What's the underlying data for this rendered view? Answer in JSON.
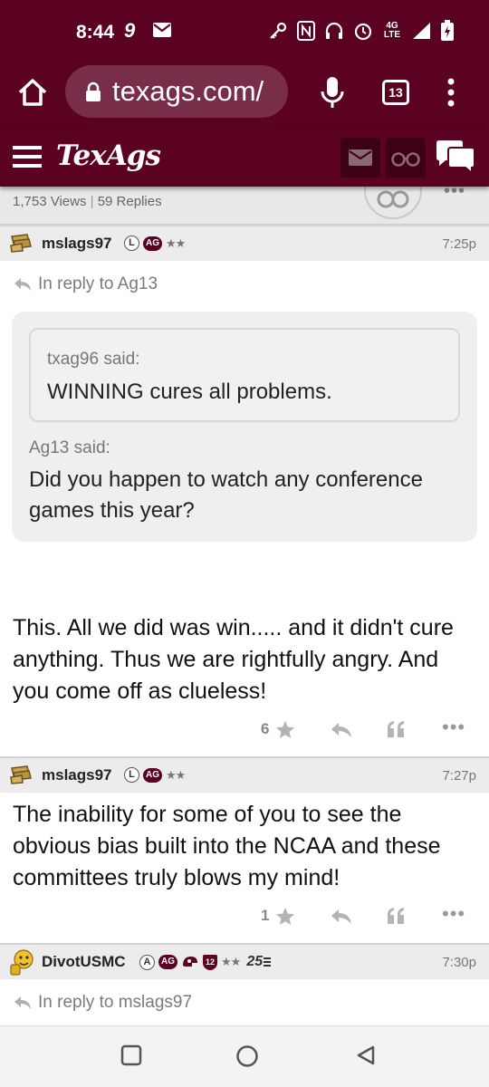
{
  "status_bar": {
    "time": "8:44",
    "network": "4G LTE"
  },
  "browser": {
    "url": "texags.com/",
    "tab_count": "13"
  },
  "site": {
    "logo": "TexAgs"
  },
  "thread": {
    "views": "1,753 Views",
    "separator": "|",
    "replies": "59 Replies"
  },
  "posts": [
    {
      "username": "mslags97",
      "badge_l": "L",
      "badge_ag": "AG",
      "stars": "★★",
      "time": "7:25p",
      "reply_to": "In reply to Ag13",
      "quote_outer_author": "Ag13 said:",
      "quote_outer_text": "Did you happen to watch any conference games this year?",
      "quote_inner_author": "txag96 said:",
      "quote_inner_text": "WINNING cures all problems.",
      "body": "This. All we did was win..... and it didn't cure anything. Thus we are rightfully angry. And you come off as clueless!",
      "likes": "6"
    },
    {
      "username": "mslags97",
      "badge_l": "L",
      "badge_ag": "AG",
      "stars": "★★",
      "time": "7:27p",
      "body": "The inability for some of you to see the obvious bias built into the NCAA and these committees truly blows my mind!",
      "likes": "1"
    },
    {
      "username": "DivotUSMC",
      "badge_l": "A",
      "badge_ag": "AG",
      "badge_num": "12",
      "stars": "★★",
      "badge_25": "25",
      "time": "7:30p",
      "reply_to": "In reply to mslags97"
    }
  ],
  "colors": {
    "maroon": "#5b0122",
    "gray_bg": "#ececec",
    "quote_bg": "#efefef"
  },
  "icons": [
    "home-icon",
    "lock-icon",
    "mic-icon",
    "tabs-icon",
    "overflow-menu-icon",
    "hamburger-icon",
    "mail-icon",
    "binoculars-icon",
    "chat-icon",
    "star-icon",
    "reply-icon",
    "quote-icon",
    "more-icon",
    "back-icon",
    "home-circle-icon",
    "recents-icon"
  ]
}
